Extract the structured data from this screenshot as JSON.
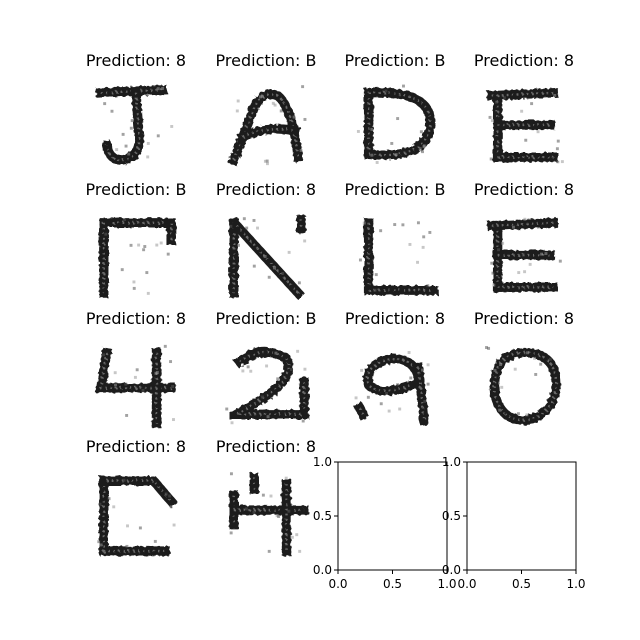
{
  "figure": {
    "cells": [
      {
        "title": "Prediction: 8",
        "glyph": "J"
      },
      {
        "title": "Prediction: B",
        "glyph": "A"
      },
      {
        "title": "Prediction: B",
        "glyph": "D"
      },
      {
        "title": "Prediction: 8",
        "glyph": "E"
      },
      {
        "title": "Prediction: B",
        "glyph": "I-corner"
      },
      {
        "title": "Prediction: 8",
        "glyph": "N"
      },
      {
        "title": "Prediction: B",
        "glyph": "L"
      },
      {
        "title": "Prediction: 8",
        "glyph": "E"
      },
      {
        "title": "Prediction: 8",
        "glyph": "4"
      },
      {
        "title": "Prediction: B",
        "glyph": "2"
      },
      {
        "title": "Prediction: 8",
        "glyph": "9"
      },
      {
        "title": "Prediction: 8",
        "glyph": "0"
      },
      {
        "title": "Prediction: 8",
        "glyph": "C"
      },
      {
        "title": "Prediction: 8",
        "glyph": "H"
      }
    ]
  },
  "chart_data": [
    {
      "type": "scatter",
      "xlim": [
        0.0,
        1.0
      ],
      "ylim": [
        0.0,
        1.0
      ],
      "xticks": [
        "0.0",
        "0.5",
        "1.0"
      ],
      "yticks": [
        "0.0",
        "0.5",
        "1.0"
      ],
      "grid": false,
      "series": []
    },
    {
      "type": "scatter",
      "xlim": [
        0.0,
        1.0
      ],
      "ylim": [
        0.0,
        1.0
      ],
      "xticks": [
        "0.0",
        "0.5",
        "1.0"
      ],
      "yticks": [
        "0.0",
        "0.5",
        "1.0"
      ],
      "grid": false,
      "series": []
    }
  ]
}
